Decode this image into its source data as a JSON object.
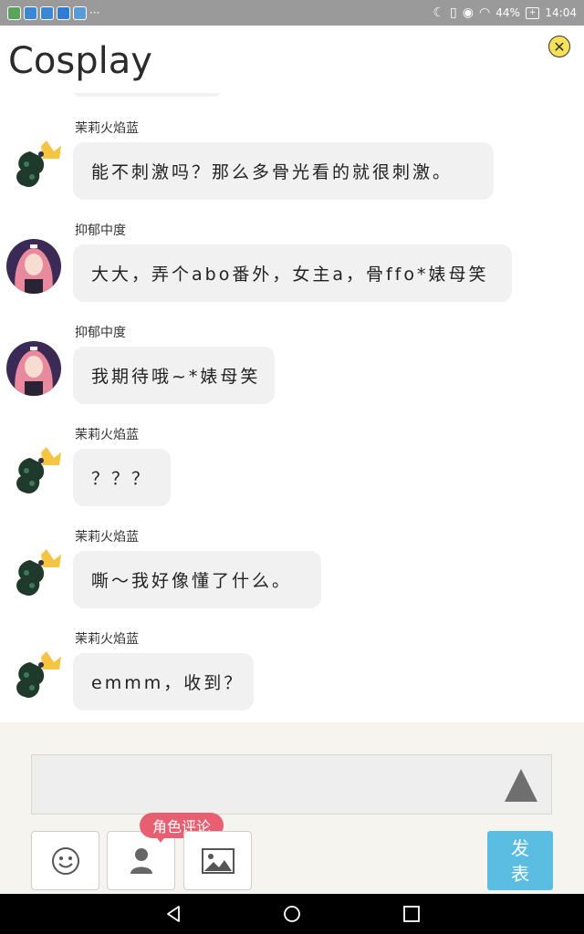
{
  "status_bar": {
    "battery_percent": "44%",
    "time": "14:04",
    "more": "···",
    "notification_colors": [
      "#5aa35a",
      "#3b86d6",
      "#3b86d6",
      "#2f7bd6",
      "#5b9bd5"
    ]
  },
  "header": {
    "title": "Cosplay",
    "close_icon": "close-icon"
  },
  "messages": [
    {
      "username": "茉莉火焰蓝",
      "text": "能不刺激吗？那么多骨光看的就很刺激。",
      "avatar": "dark-character-with-crown"
    },
    {
      "username": "抑郁中度",
      "text": "大大，弄个abo番外，女主a，骨ffo*婊母笑",
      "avatar": "pink-hair-girl"
    },
    {
      "username": "抑郁中度",
      "text": "我期待哦~*婊母笑",
      "avatar": "pink-hair-girl"
    },
    {
      "username": "茉莉火焰蓝",
      "text": "？？？",
      "avatar": "dark-character-with-crown"
    },
    {
      "username": "茉莉火焰蓝",
      "text": "嘶～我好像懂了什么。",
      "avatar": "dark-character-with-crown"
    },
    {
      "username": "茉莉火焰蓝",
      "text": "emmm，收到？",
      "avatar": "dark-character-with-crown"
    }
  ],
  "input": {
    "placeholder": "",
    "value": ""
  },
  "toolbar": {
    "role_comment_label": "角色评论",
    "publish_label_line1": "发",
    "publish_label_line2": "表",
    "accent_color": "#5bbde2",
    "tag_color": "#e95f72"
  },
  "navigation": {
    "back": "back-icon",
    "home": "home-icon",
    "recents": "recents-icon"
  }
}
